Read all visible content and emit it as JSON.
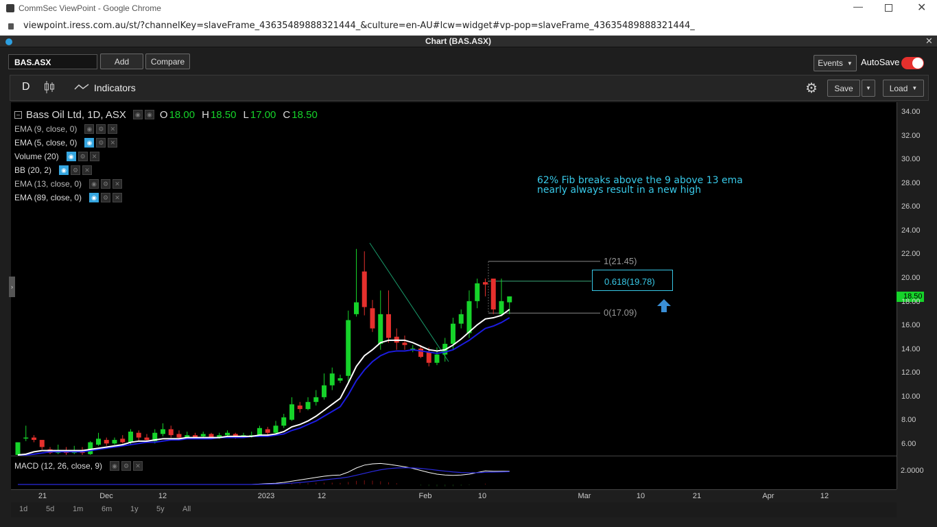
{
  "browser": {
    "window_title": "CommSec ViewPoint - Google Chrome",
    "url": "viewpoint.iress.com.au/st/?channelKey=slaveFrame_43635489888321444_&culture=en-AU#lcw=widget#vp-pop=slaveFrame_43635489888321444_"
  },
  "panel": {
    "title": "Chart (BAS.ASX)"
  },
  "toolbar": {
    "symbol": "BAS.ASX",
    "add": "Add",
    "compare": "Compare",
    "events": "Events",
    "autosave": "AutoSave",
    "period": "D",
    "indicators": "Indicators",
    "save": "Save",
    "load": "Load"
  },
  "legend": {
    "title": "Bass Oil Ltd, 1D, ASX",
    "o_label": "O",
    "o": "18.00",
    "h_label": "H",
    "h": "18.50",
    "l_label": "L",
    "l": "17.00",
    "c_label": "C",
    "c": "18.50"
  },
  "studies": [
    "EMA (9, close, 0)",
    "EMA (5, close, 0)",
    "Volume (20)",
    "BB (20, 2)",
    "EMA (13, close, 0)",
    "EMA (89, close, 0)"
  ],
  "annotation": {
    "line1": "62% Fib breaks above the 9 above 13 ema",
    "line2": "nearly always result in a new high"
  },
  "fib": {
    "top": "1(21.45)",
    "mid": "0.618(19.78)",
    "bot": "0(17.09)"
  },
  "price_tag": "18.50",
  "macd": {
    "label": "MACD (12, 26, close, 9)",
    "axis": "2.0000"
  },
  "chart_data": {
    "type": "candlestick",
    "y_ticks": [
      "34.00",
      "32.00",
      "30.00",
      "28.00",
      "26.00",
      "24.00",
      "22.00",
      "20.00",
      "18.00",
      "16.00",
      "14.00",
      "12.00",
      "10.00",
      "8.00",
      "6.00"
    ],
    "ylim": [
      5,
      35
    ],
    "x_labels": [
      "21",
      "Dec",
      "12",
      "2023",
      "12",
      "Feb",
      "10",
      "Mar",
      "10",
      "21",
      "Apr",
      "12"
    ],
    "candles": [
      [
        5,
        6.2,
        5.1,
        6.2
      ],
      [
        6.6,
        6.6,
        6.3,
        7.6
      ],
      [
        6.6,
        6.4,
        6.2,
        6.8
      ],
      [
        6.4,
        5.8,
        5.6,
        6.4
      ],
      [
        5.6,
        5.3,
        5.2,
        5.8
      ],
      [
        5.3,
        5.5,
        5.2,
        6.0
      ],
      [
        5.5,
        5.3,
        5.1,
        5.8
      ],
      [
        5.3,
        5.5,
        5.2,
        5.9
      ],
      [
        5.4,
        5.3,
        5.1,
        5.8
      ],
      [
        5.2,
        6.2,
        5.1,
        6.3
      ],
      [
        6.0,
        6.5,
        5.9,
        7.0
      ],
      [
        6.4,
        6.1,
        5.9,
        6.6
      ],
      [
        6.1,
        6.4,
        6.0,
        6.6
      ],
      [
        6.5,
        6.2,
        6.1,
        6.8
      ],
      [
        6.2,
        7.1,
        6.0,
        7.3
      ],
      [
        7.0,
        6.6,
        6.3,
        7.2
      ],
      [
        6.6,
        6.4,
        6.2,
        6.9
      ],
      [
        6.3,
        7.0,
        6.1,
        7.3
      ],
      [
        6.9,
        7.3,
        6.7,
        7.8
      ],
      [
        7.3,
        6.8,
        6.6,
        7.6
      ],
      [
        6.9,
        6.6,
        6.4,
        7.2
      ],
      [
        6.6,
        6.8,
        6.5,
        7.1
      ],
      [
        6.8,
        6.6,
        6.5,
        7.0
      ],
      [
        6.7,
        6.9,
        6.5,
        7.1
      ],
      [
        6.9,
        6.6,
        6.5,
        7.0
      ],
      [
        6.6,
        6.8,
        6.5,
        7.0
      ],
      [
        6.8,
        7.0,
        6.6,
        7.2
      ],
      [
        6.9,
        6.7,
        6.5,
        7.0
      ],
      [
        6.7,
        6.8,
        6.6,
        7.0
      ],
      [
        6.8,
        6.8,
        6.6,
        7.1
      ],
      [
        6.8,
        7.4,
        6.7,
        7.6
      ],
      [
        7.3,
        7.0,
        6.8,
        7.5
      ],
      [
        7.0,
        7.6,
        6.9,
        8.0
      ],
      [
        7.6,
        8.3,
        7.4,
        8.6
      ],
      [
        8.1,
        9.4,
        8.0,
        10.0
      ],
      [
        9.3,
        9.0,
        8.7,
        9.6
      ],
      [
        9.0,
        9.6,
        8.9,
        10.0
      ],
      [
        9.6,
        10.0,
        9.3,
        10.6
      ],
      [
        10.0,
        11.0,
        9.8,
        12.0
      ],
      [
        11.0,
        12.0,
        10.6,
        12.5
      ],
      [
        11.4,
        11.6,
        11.2,
        11.9
      ],
      [
        11.8,
        16.5,
        11.3,
        17.3
      ],
      [
        17.0,
        18.0,
        16.8,
        22.5
      ],
      [
        20.6,
        17.6,
        16.9,
        22.3
      ],
      [
        17.5,
        15.8,
        15.5,
        18.2
      ],
      [
        14.5,
        17.0,
        14.0,
        19.0
      ],
      [
        17.0,
        15.0,
        14.6,
        19.0
      ],
      [
        15.1,
        14.6,
        14.0,
        15.8
      ],
      [
        14.6,
        14.4,
        14.0,
        15.2
      ],
      [
        14.1,
        14.1,
        13.8,
        14.4
      ],
      [
        14.1,
        13.4,
        13.3,
        14.4
      ],
      [
        13.8,
        12.9,
        12.6,
        14.2
      ],
      [
        12.9,
        13.6,
        12.7,
        14.2
      ],
      [
        13.6,
        14.5,
        13.0,
        15.0
      ],
      [
        14.5,
        16.2,
        14.0,
        16.7
      ],
      [
        16.2,
        17.0,
        15.8,
        17.4
      ],
      [
        15.4,
        18.1,
        15.0,
        19.0
      ],
      [
        18.1,
        19.6,
        17.5,
        20.0
      ],
      [
        19.7,
        19.5,
        18.5,
        20.0
      ],
      [
        20.0,
        17.4,
        17.0,
        20.0
      ],
      [
        17.0,
        18.1,
        16.9,
        20.0
      ],
      [
        18.0,
        18.5,
        17.0,
        18.5
      ]
    ],
    "ema_white": [
      5.1,
      5.2,
      5.4,
      5.5,
      5.5,
      5.5,
      5.5,
      5.5,
      5.5,
      5.6,
      5.7,
      5.8,
      5.9,
      6.0,
      6.2,
      6.3,
      6.3,
      6.4,
      6.5,
      6.5,
      6.5,
      6.6,
      6.6,
      6.6,
      6.6,
      6.6,
      6.7,
      6.7,
      6.7,
      6.7,
      6.8,
      6.8,
      6.9,
      7.1,
      7.5,
      7.7,
      8.0,
      8.4,
      8.9,
      9.4,
      9.9,
      11.2,
      12.6,
      13.5,
      14.0,
      14.6,
      14.8,
      14.8,
      14.8,
      14.6,
      14.3,
      14.0,
      13.9,
      14.0,
      14.4,
      14.9,
      15.5,
      16.1,
      16.6,
      16.7,
      16.9,
      17.4
    ],
    "ema_blue": [
      5.0,
      5.1,
      5.2,
      5.3,
      5.4,
      5.4,
      5.4,
      5.4,
      5.4,
      5.5,
      5.6,
      5.7,
      5.8,
      5.9,
      6.0,
      6.1,
      6.2,
      6.2,
      6.3,
      6.4,
      6.4,
      6.5,
      6.5,
      6.5,
      6.5,
      6.6,
      6.6,
      6.6,
      6.6,
      6.7,
      6.7,
      6.7,
      6.8,
      6.9,
      7.2,
      7.4,
      7.7,
      8.0,
      8.4,
      8.8,
      9.2,
      10.2,
      11.4,
      12.3,
      13.0,
      13.5,
      13.8,
      13.9,
      13.9,
      14.0,
      13.9,
      13.8,
      13.7,
      13.8,
      14.0,
      14.4,
      14.8,
      15.3,
      15.8,
      16.0,
      16.3,
      16.7
    ],
    "macd": [
      0,
      0,
      0,
      0,
      0,
      0,
      0,
      0,
      0,
      0,
      0,
      0,
      0,
      0,
      0,
      0,
      0,
      0,
      0,
      0,
      0,
      0,
      0,
      0,
      0,
      0,
      0,
      0,
      0,
      0,
      0.05,
      0.1,
      0.15,
      0.25,
      0.4,
      0.55,
      0.7,
      0.85,
      1.0,
      1.1,
      1.15,
      1.5,
      2.0,
      2.35,
      2.5,
      2.55,
      2.45,
      2.3,
      2.15,
      1.95,
      1.7,
      1.45,
      1.25,
      1.15,
      1.1,
      1.15,
      1.25,
      1.45,
      1.65,
      1.6,
      1.6,
      1.6
    ],
    "macd_signal": [
      0,
      0,
      0,
      0,
      0,
      0,
      0,
      0,
      0,
      0,
      0,
      0,
      0,
      0,
      0,
      0,
      0,
      0,
      0,
      0,
      0,
      0,
      0,
      0,
      0,
      0,
      0,
      0,
      0,
      0,
      0.02,
      0.04,
      0.07,
      0.1,
      0.16,
      0.24,
      0.33,
      0.43,
      0.55,
      0.66,
      0.76,
      0.9,
      1.12,
      1.35,
      1.58,
      1.78,
      1.92,
      2.0,
      2.03,
      2.01,
      1.95,
      1.85,
      1.73,
      1.62,
      1.52,
      1.45,
      1.42,
      1.43,
      1.47,
      1.5,
      1.52,
      1.55
    ]
  },
  "range_buttons": [
    "1d",
    "5d",
    "1m",
    "6m",
    "1y",
    "5y",
    "All"
  ],
  "colors": {
    "up": "#16d32a",
    "down": "#e5302d",
    "ema_fast": "#ffffff",
    "ema_slow": "#1c1ce0",
    "annotation": "#38c9e8",
    "trendline": "#1a9a6a",
    "price_tag": "#16d32a",
    "arrow": "#3a8fd6"
  }
}
